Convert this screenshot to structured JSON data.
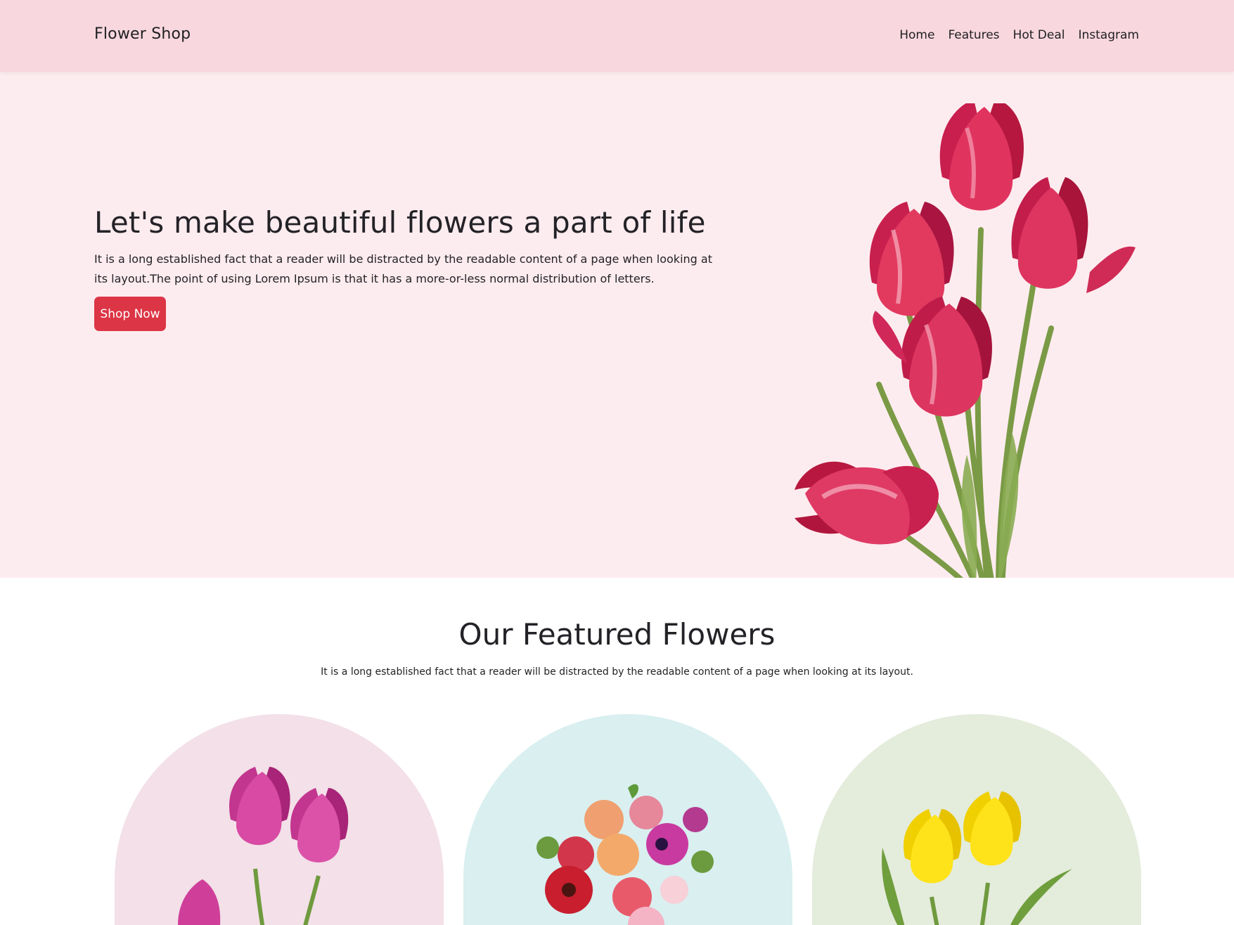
{
  "navbar": {
    "brand": "Flower Shop",
    "links": [
      "Home",
      "Features",
      "Hot Deal",
      "Instagram"
    ]
  },
  "hero": {
    "title": "Let's make beautiful flowers a part of life",
    "text": "It is a long established fact that a reader will be distracted by the readable content of a page when looking at its layout.The point of using Lorem Ipsum is that it has a more-or-less normal distribution of letters.",
    "button": "Shop Now",
    "image_icon": "red-tulips-bouquet"
  },
  "featured": {
    "title": "Our Featured Flowers",
    "subtitle": "It is a long established fact that a reader will be distracted by the readable content of a page when looking at its layout.",
    "cards": [
      {
        "bg": "#f3e0e8",
        "icon": "pink-tulips"
      },
      {
        "bg": "#d9eff0",
        "icon": "mixed-bouquet"
      },
      {
        "bg": "#e4ecdc",
        "icon": "yellow-tulips"
      }
    ]
  },
  "colors": {
    "navbar_bg": "#f8d7de",
    "hero_bg": "#fdecef",
    "button_bg": "#dc3545"
  }
}
